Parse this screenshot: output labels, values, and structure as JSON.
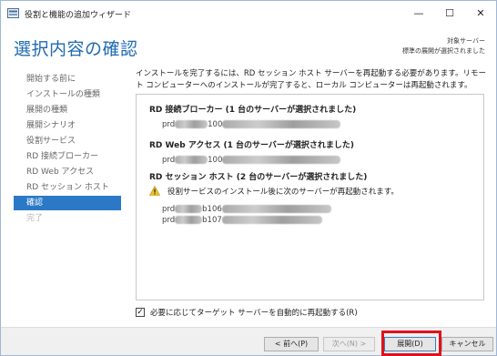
{
  "window": {
    "title": "役割と機能の追加ウィザード",
    "controls": {
      "minimize": "—",
      "maximize": "☐",
      "close": "✕"
    }
  },
  "header": {
    "page_title": "選択内容の確認",
    "target_label": "対象サーバー",
    "target_value": "標準の展開が選択されました"
  },
  "nav": {
    "items": [
      {
        "label": "開始する前に",
        "state": "normal"
      },
      {
        "label": "インストールの種類",
        "state": "normal"
      },
      {
        "label": "展開の種類",
        "state": "normal"
      },
      {
        "label": "展開シナリオ",
        "state": "normal"
      },
      {
        "label": "役割サービス",
        "state": "normal"
      },
      {
        "label": "RD 接続ブローカー",
        "state": "normal"
      },
      {
        "label": "RD Web アクセス",
        "state": "normal"
      },
      {
        "label": "RD セッション ホスト",
        "state": "normal"
      },
      {
        "label": "確認",
        "state": "active"
      },
      {
        "label": "完了",
        "state": "disabled"
      }
    ]
  },
  "content": {
    "intro": "インストールを完了するには、RD セッション ホスト サーバーを再起動する必要があります。リモート コンピューターへのインストールが完了すると、ローカル コンピューターは再起動されます。",
    "sections": [
      {
        "heading": "RD 接続ブローカー (1 台のサーバーが選択されました)",
        "servers": [
          {
            "prefix": "prd",
            "suffix": "100"
          }
        ]
      },
      {
        "heading": "RD Web アクセス (1 台のサーバーが選択されました)",
        "servers": [
          {
            "prefix": "prd",
            "suffix": "100"
          }
        ]
      },
      {
        "heading": "RD セッション ホスト (2 台のサーバーが選択されました)",
        "warning": "役割サービスのインストール後に次のサーバーが再起動されます。",
        "servers": [
          {
            "prefix": "prd",
            "suffix": "b106"
          },
          {
            "prefix": "prd",
            "suffix": "b107"
          }
        ]
      }
    ],
    "restart_checkbox": {
      "label": "必要に応じてターゲット サーバーを自動的に再起動する(R)",
      "checked": true,
      "mark": "✓"
    }
  },
  "footer": {
    "prev": "< 前へ(P)",
    "next": "次へ(N) >",
    "deploy": "展開(D)",
    "cancel": "キャンセル"
  },
  "colors": {
    "accent": "#2b79c6",
    "title": "#1f6ab3",
    "highlight": "#e0101c"
  }
}
